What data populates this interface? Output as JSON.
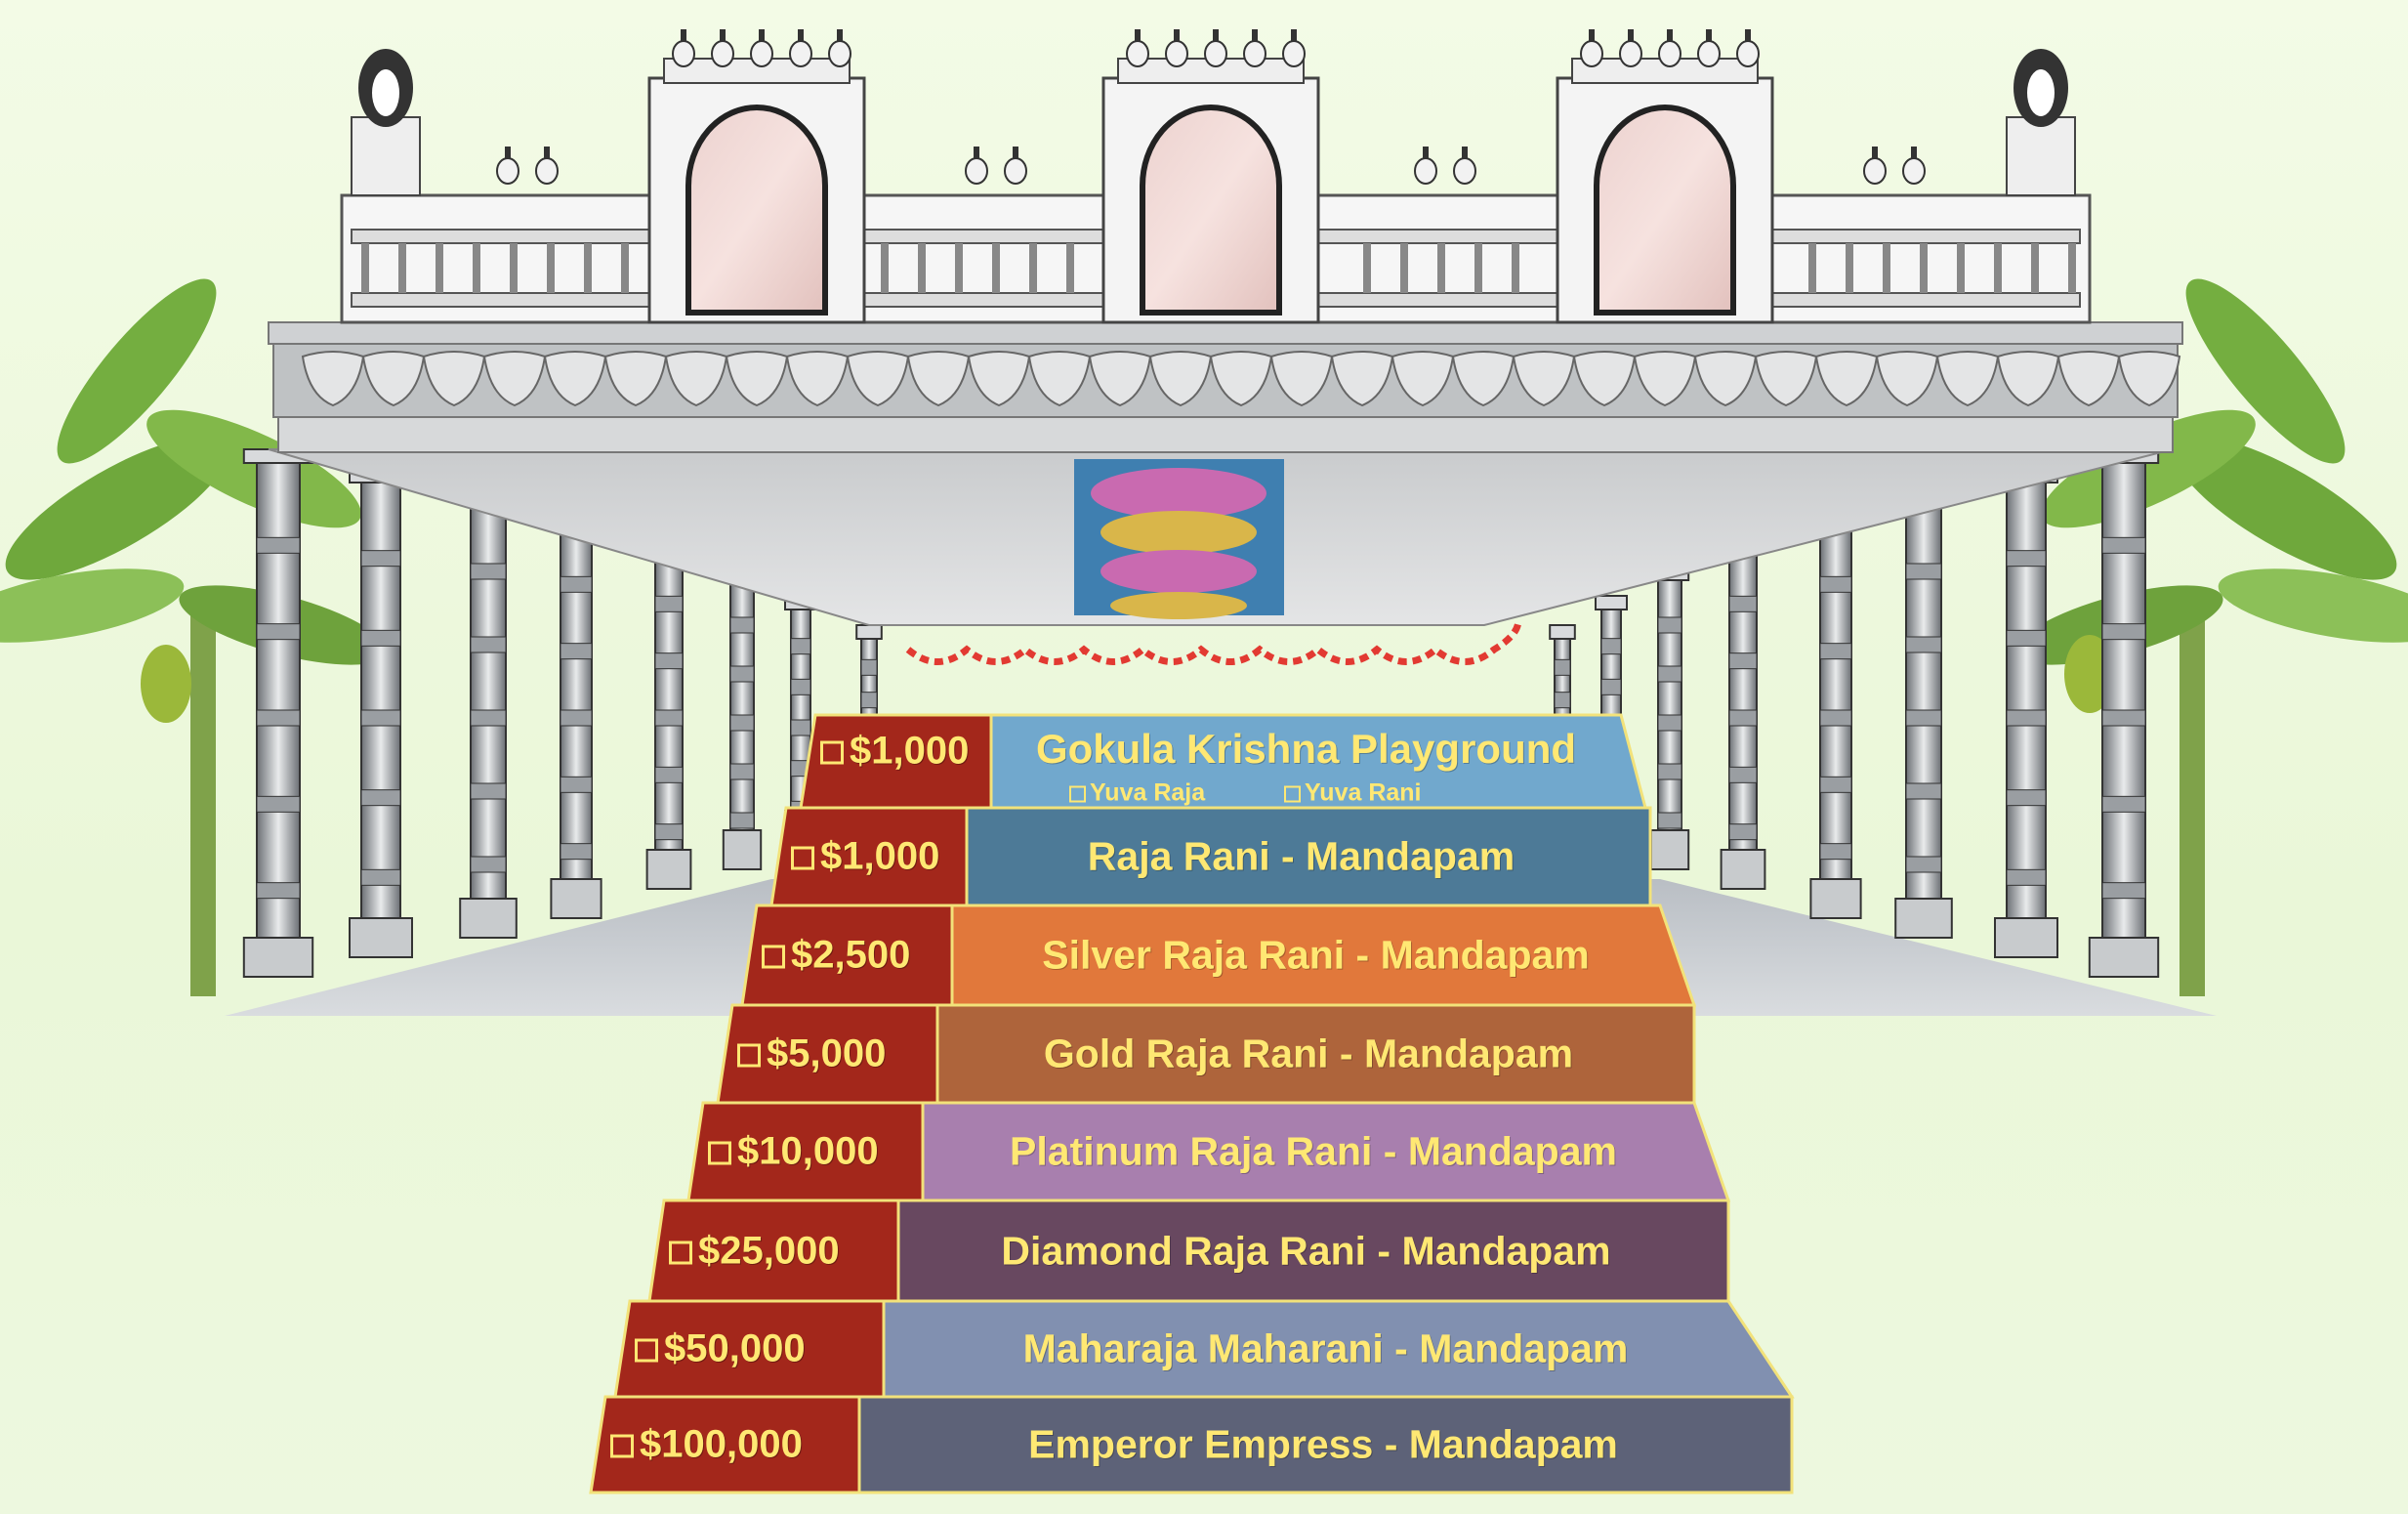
{
  "colors": {
    "price_column": "#a3271b",
    "label_text": "#ffe873",
    "background": "#eef8e0"
  },
  "steps": [
    {
      "price": "$1,000",
      "label": "Gokula Krishna Playground",
      "color": "#71a8cd"
    },
    {
      "price": "$1,000",
      "label": "Raja Rani - Mandapam",
      "color": "#4d7a97"
    },
    {
      "price": "$2,500",
      "label": "Silver Raja Rani - Mandapam",
      "color": "#e1783b"
    },
    {
      "price": "$5,000",
      "label": "Gold Raja Rani - Mandapam",
      "color": "#ae643b"
    },
    {
      "price": "$10,000",
      "label": "Platinum Raja Rani - Mandapam",
      "color": "#a87fae"
    },
    {
      "price": "$25,000",
      "label": "Diamond Raja Rani - Mandapam",
      "color": "#684860"
    },
    {
      "price": "$50,000",
      "label": "Maharaja Maharani - Mandapam",
      "color": "#8190b0"
    },
    {
      "price": "$100,000",
      "label": "Emperor Empress - Mandapam",
      "color": "#5d6278"
    }
  ],
  "playground_options": [
    "Yuva Raja",
    "Yuva Rani"
  ]
}
